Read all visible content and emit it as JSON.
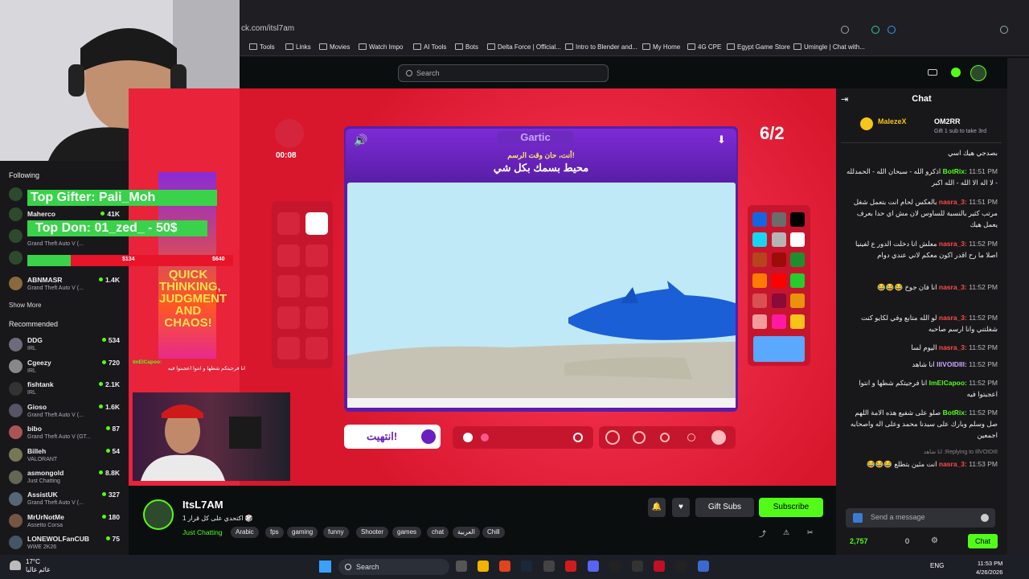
{
  "browser": {
    "url": "ck.com/itsl7am",
    "bookmarks": [
      "Tools",
      "Links",
      "Movies",
      "Watch Impo",
      "AI Tools",
      "Bots",
      "Delta Force | Official...",
      "Intro to Blender and...",
      "My Home",
      "4G CPE",
      "Egypt Game Store",
      "Umingle | Chat with..."
    ]
  },
  "header": {
    "search_placeholder": "Search"
  },
  "sidebar": {
    "following_title": "Following",
    "following": [
      {
        "name": "Maherco",
        "game": "",
        "viewers": "41K"
      },
      {
        "name": "",
        "game": "Grand Theft Auto V (...",
        "viewers": ""
      },
      {
        "name": "ABNMASR",
        "game": "Grand Theft Auto V (...",
        "viewers": "1.4K"
      }
    ],
    "show_more": "Show More",
    "recommended_title": "Recommended",
    "recommended": [
      {
        "name": "DDG",
        "game": "IRL",
        "viewers": "534"
      },
      {
        "name": "Cgeezy",
        "game": "IRL",
        "viewers": "720"
      },
      {
        "name": "fishtank",
        "game": "IRL",
        "viewers": "2.1K"
      },
      {
        "name": "Gioso",
        "game": "Grand Theft Auto V (...",
        "viewers": "1.6K"
      },
      {
        "name": "bibo",
        "game": "Grand Theft Auto V (GT...",
        "viewers": "87"
      },
      {
        "name": "Billeh",
        "game": "VALORANT",
        "viewers": "54"
      },
      {
        "name": "asmongold",
        "game": "Just Chatting",
        "viewers": "8.8K"
      },
      {
        "name": "AssistUK",
        "game": "Grand Theft Auto V (...",
        "viewers": "327"
      },
      {
        "name": "MrUrNotMe",
        "game": "Assetto Corsa",
        "viewers": "180"
      },
      {
        "name": "LONEWOLFanCUB",
        "game": "WWE 2K26",
        "viewers": "75"
      }
    ]
  },
  "overlay": {
    "top_gifter": "Top Gifter: Pali_Moh",
    "top_donation": "Top Don: 01_zed_ - 50$",
    "goal_current": "$134",
    "goal_target": "$640",
    "goal_fraction": 0.21,
    "promo_text": "QUICK THINKING, JUDGMENT AND CHAOS!",
    "mini_chat_user": "ImElCapoo:",
    "mini_chat_text": "انا فرجيتكم شطها و انتوا اعجبتوا فيه"
  },
  "game": {
    "logo": "Gartic",
    "timer": "00:08",
    "round": "6/2",
    "turn_text": "أنت، حان وقت الرسم!",
    "word": "محيط بسمك بكل شي",
    "done_label": "انتهيت!",
    "colors": [
      "#1565e0",
      "#6c6c6c",
      "#000000",
      "#18d6f2",
      "#b5b5b5",
      "#ffffff",
      "#b6441c",
      "#9e0b0b",
      "#1f8f2e",
      "#ff7a00",
      "#ff0000",
      "#26cc2d",
      "#d85050",
      "#8a0a3a",
      "#e8930a",
      "#f59a9a",
      "#ff1aa0",
      "#f7c21a"
    ],
    "selected_color": "#5aa8ff"
  },
  "stream": {
    "name": "ItsL7AM",
    "title": "1 اكتحدي على كل قرار 🎲",
    "category": "Just Chatting",
    "tags": [
      "Arabic",
      "fps",
      "gaming",
      "funny",
      "Shooter",
      "games",
      "chat",
      "العربية",
      "Chill"
    ],
    "gift_label": "Gift Subs",
    "subscribe_label": "Subscribe"
  },
  "chat": {
    "title": "Chat",
    "pinned_user1": "MalezeX",
    "pinned_user2": "OM2RR",
    "pinned_text": "Gift 1 sub to take 3rd",
    "messages": [
      {
        "time": "",
        "user": "",
        "text": "بصدجي هيك اسي"
      },
      {
        "time": "11:51 PM",
        "user": "BotRix:",
        "text": "اذكرو الله - سبحان الله - الحمدلله - لا اله الا الله - الله اكبر"
      },
      {
        "time": "11:51 PM",
        "user": "nasra_3:",
        "text": "بالعكس لحام انت بتعمل شغل مرتب كثير بالنسبة للساوس لان مش اي حدا بعرف يعمل هيك"
      },
      {
        "time": "11:52 PM",
        "user": "nasra_3:",
        "text": "معلش انا دخلت الدور ع لفينيا اصلا ما رح اقدر اكون معكم لاني عندي دوام"
      },
      {
        "time": "11:52 PM",
        "user": "nasra_3:",
        "text": "انا فان جوخ 😂😂😂"
      },
      {
        "time": "11:52 PM",
        "user": "nasra_3:",
        "text": "لو الله متابع وفي لكايو كنت شغلتني وانا ارسم صاحبه"
      },
      {
        "time": "11:52 PM",
        "user": "nasra_3:",
        "text": "اليوم لسا"
      },
      {
        "time": "11:52 PM",
        "user": "IllVOIDIII:",
        "text": "انا شاهد"
      },
      {
        "time": "11:52 PM",
        "user": "ImElCapoo:",
        "text": "انا فرجيتكم شطها و انتوا اعجبتوا فيه"
      },
      {
        "time": "11:52 PM",
        "user": "BotRix:",
        "text": "صلو على شفيع هذه الامة اللهم صل وسلم وبارك على سيدنا محمد وعلى اله واصحابه اجمعين"
      },
      {
        "time": "",
        "user": "",
        "text": "Replying to IllVOIDIII: انا شاهد"
      },
      {
        "time": "11:53 PM",
        "user": "nasra_3:",
        "text": "انت مئين بتطلع 😂😂😂"
      }
    ],
    "input_placeholder": "Send a message",
    "points": "2,757",
    "count": "0",
    "chat_button": "Chat"
  },
  "taskbar": {
    "temp": "17°C",
    "weather_text": "غائم غالبا",
    "search": "Search",
    "lang": "ENG",
    "time": "11:53 PM",
    "date": "4/26/2026"
  }
}
